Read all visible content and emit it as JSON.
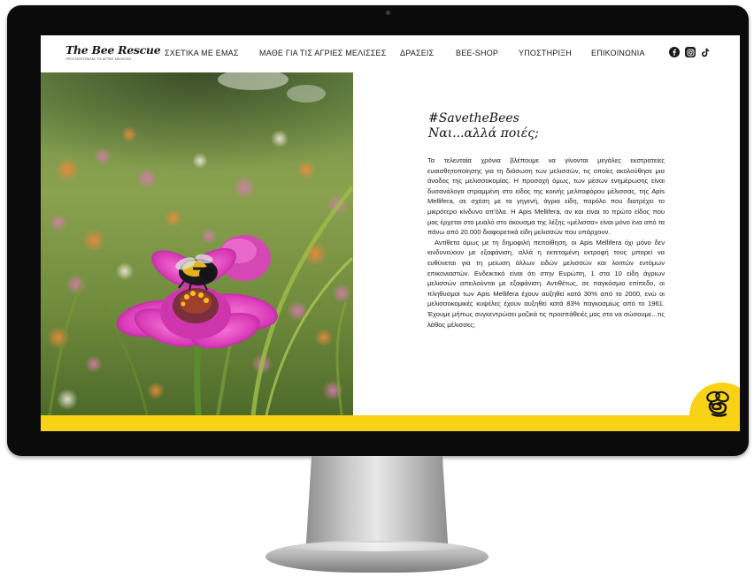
{
  "site": {
    "logo_text": "The Bee Rescue",
    "logo_tagline": "ΠΡΟΣΤΑΤΕΥΟΝΤΑΣ ΤΙΣ ΑΓΡΙΕΣ ΜΕΛΙΣΣΕΣ"
  },
  "nav": {
    "items": [
      {
        "label": "ΣΧΕΤΙΚΑ ΜΕ ΕΜΑΣ"
      },
      {
        "label": "ΜΑΘΕ ΓΙΑ ΤΙΣ ΑΓΡΙΕΣ ΜΕΛΙΣΣΕΣ"
      },
      {
        "label": "ΔΡΑΣΕΙΣ"
      },
      {
        "label": "BEE-SHOP"
      },
      {
        "label": "ΥΠΟΣΤΗΡΙΞΗ"
      },
      {
        "label": "ΕΠΙΚΟΙΝΩΝΙΑ"
      }
    ],
    "social": [
      {
        "icon": "facebook-icon"
      },
      {
        "icon": "instagram-icon"
      },
      {
        "icon": "tiktok-icon"
      }
    ]
  },
  "hero": {
    "image_icon": "bee-on-flower-photo"
  },
  "article": {
    "hashtag": "#SavetheBees",
    "subhead": "Ναι...αλλά ποιές;",
    "paragraph_1": "Τα τελευταία χρόνια βλέπουμε να γίνονται μεγάλες εκστρατείες ευαισθητοποίησης για τη διάσωση των μελισσών, τις οποίες ακολούθησε μια άνοδος της μελισσοκομίας. Η προσοχή όμως, των μέσων ενημέρωσης είναι δυσανάλογα στραμμένη στο είδος της κοινής μελιτοφόρου μέλισσας, της Apis Mellifera, σε σχέση με τα γηγενή, άγρια είδη, παρόλο που διατρέχει το μικρότερο κίνδυνο απ'όλα. Η Apis Mellifera, αν και είναι το πρώτο είδος που μας έρχεται στο μυαλό στο άκουσμα της λέξης «μέλισσα» είναι μόνο ένα από τα πάνω από 20.000 διαφορετικά είδη μελισσών που υπάρχουν.",
    "paragraph_2": "Αντίθετα όμως με τη δημοφιλή πεποίθηση, οι Apis Mellifera όχι μόνο δεν κινδυνεύουν με εξαφάνιση, αλλά η εκτεταμένη εκτροφή τους μπορεί να ευθύνεται για τη μείωση άλλων ειδών μελισσών και λοιπών εντόμων επικονιαστών. Ενδεικτικό είναι ότι στην Ευρώπη, 1 στα 10 είδη άγριων μελισσών απειλούνται με εξαφάνιση. Αντιθέτως, σε παγκόσμιο επίπεδο, οι πληθυσμοί των Apis Mellifera έχουν αυξηθεί κατά 30% από το 2000, ενώ οι μελισσοκομικές κυψέλες έχουν αυξηθεί κατά 83% παγκοσμίως από το 1961. Έχουμε μήπως συγκεντρώσει μαζικά τις προσπάθειές μας στο να σώσουμε...τις λάθος μέλισσες;"
  },
  "colors": {
    "accent_yellow": "#f7d215",
    "text_dark": "#1a1a1a",
    "bezel": "#0b0b0b"
  }
}
